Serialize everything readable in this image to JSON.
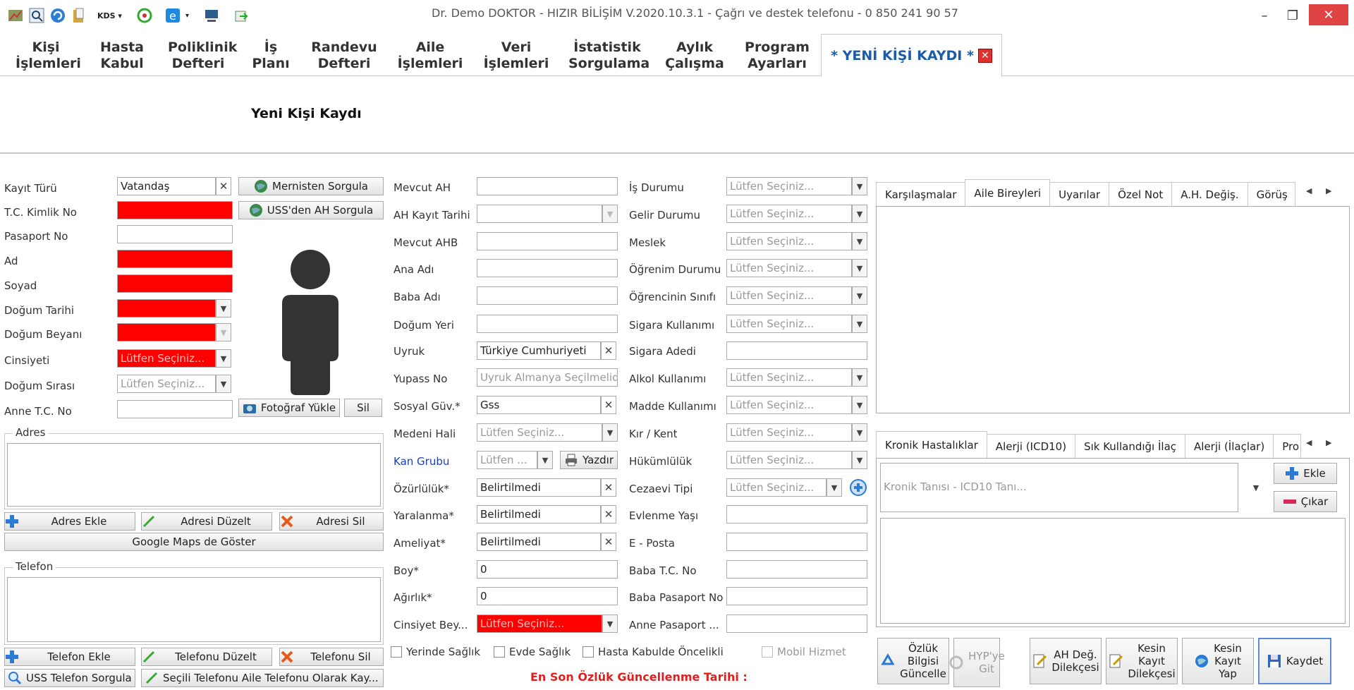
{
  "window": {
    "title": "Dr. Demo DOKTOR - HIZIR BİLİŞİM V.2020.10.3.1 - Çağrı ve destek telefonu - 0 850 241 90 57",
    "kds": "KDS"
  },
  "menu": [
    {
      "l1": "Kişi",
      "l2": "İşlemleri"
    },
    {
      "l1": "Hasta",
      "l2": "Kabul"
    },
    {
      "l1": "Poliklinik",
      "l2": "Defteri"
    },
    {
      "l1": "İş",
      "l2": "Planı"
    },
    {
      "l1": "Randevu",
      "l2": "Defteri"
    },
    {
      "l1": "Aile",
      "l2": "İşlemleri"
    },
    {
      "l1": "Veri",
      "l2": "İşlemleri"
    },
    {
      "l1": "İstatistik",
      "l2": "Sorgulama"
    },
    {
      "l1": "Aylık",
      "l2": "Çalışma"
    },
    {
      "l1": "Program",
      "l2": "Ayarları"
    }
  ],
  "active_tab": "* YENİ KİŞİ KAYDI *",
  "header_title": "Yeni Kişi Kaydı",
  "col1": {
    "kayit_turu": {
      "label": "Kayıt Türü",
      "value": "Vatandaş"
    },
    "tc": {
      "label": "T.C. Kimlik No"
    },
    "pasaport": {
      "label": "Pasaport No"
    },
    "ad": {
      "label": "Ad"
    },
    "soyad": {
      "label": "Soyad"
    },
    "dogum_tarihi": {
      "label": "Doğum Tarihi"
    },
    "dogum_beyani": {
      "label": "Doğum Beyanı"
    },
    "cinsiyet": {
      "label": "Cinsiyeti",
      "value": "Lütfen Seçiniz..."
    },
    "dogum_sirasi": {
      "label": "Doğum Sırası",
      "value": "Lütfen Seçiniz..."
    },
    "anne_tc": {
      "label": "Anne T.C. No"
    },
    "mernis_btn": "Mernisten Sorgula",
    "uss_btn": "USS'den AH Sorgula",
    "foto_btn": "Fotoğraf Yükle",
    "sil_btn": "Sil",
    "adres_title": "Adres",
    "adres_ekle": "Adres Ekle",
    "adres_duzelt": "Adresi Düzelt",
    "adres_sil": "Adresi Sil",
    "google_maps": "Google Maps de Göster",
    "telefon_title": "Telefon",
    "telefon_ekle": "Telefon Ekle",
    "telefon_duzelt": "Telefonu Düzelt",
    "telefon_sil": "Telefonu Sil",
    "uss_telefon": "USS Telefon Sorgula",
    "secili_telefon": "Seçili Telefonu Aile Telefonu Olarak Kay..."
  },
  "col2": {
    "mevcut_ah": {
      "label": "Mevcut AH"
    },
    "ah_kayit_tarihi": {
      "label": "AH Kayıt Tarihi"
    },
    "mevcut_ahb": {
      "label": "Mevcut AHB"
    },
    "ana_adi": {
      "label": "Ana Adı"
    },
    "baba_adi": {
      "label": "Baba Adı"
    },
    "dogum_yeri": {
      "label": "Doğum Yeri"
    },
    "uyruk": {
      "label": "Uyruk",
      "value": "Türkiye Cumhuriyeti"
    },
    "yupass": {
      "label": "Yupass  No",
      "placeholder": "Uyruk Almanya Seçilmelidir"
    },
    "sosyal_guv": {
      "label": "Sosyal Güv.*",
      "value": "Gss"
    },
    "medeni_hali": {
      "label": "Medeni Hali",
      "value": "Lütfen Seçiniz..."
    },
    "kan_grubu": {
      "label": "Kan Grubu",
      "value": "Lütfen ..."
    },
    "yazdir": "Yazdır",
    "ozurluluk": {
      "label": "Özürlülük*",
      "value": "Belirtilmedi"
    },
    "yaralanma": {
      "label": "Yaralanma*",
      "value": "Belirtilmedi"
    },
    "ameliyat": {
      "label": "Ameliyat*",
      "value": "Belirtilmedi"
    },
    "boy": {
      "label": "Boy*",
      "value": "0"
    },
    "agirlik": {
      "label": "Ağırlık*",
      "value": "0"
    },
    "cinsiyet_bey": {
      "label": "Cinsiyet Bey...",
      "value": "Lütfen Seçiniz..."
    }
  },
  "col3": {
    "is_durumu": {
      "label": "İş Durumu",
      "value": "Lütfen Seçiniz..."
    },
    "gelir_durumu": {
      "label": "Gelir Durumu",
      "value": "Lütfen Seçiniz..."
    },
    "meslek": {
      "label": "Meslek",
      "value": "Lütfen Seçiniz..."
    },
    "ogrenim": {
      "label": "Öğrenim Durumu",
      "value": "Lütfen Seçiniz..."
    },
    "ogrenci_sinifi": {
      "label": "Öğrencinin Sınıfı",
      "value": "Lütfen Seçiniz..."
    },
    "sigara_kul": {
      "label": "Sigara Kullanımı",
      "value": "Lütfen Seçiniz..."
    },
    "sigara_adedi": {
      "label": "Sigara Adedi"
    },
    "alkol": {
      "label": "Alkol Kullanımı",
      "value": "Lütfen Seçiniz..."
    },
    "madde": {
      "label": "Madde Kullanımı",
      "value": "Lütfen Seçiniz..."
    },
    "kir_kent": {
      "label": "Kır / Kent",
      "value": "Lütfen Seçiniz..."
    },
    "hukumluluk": {
      "label": "Hükümlülük",
      "value": "Lütfen Seçiniz..."
    },
    "cezaevi": {
      "label": "Cezaevi Tipi",
      "value": "Lütfen Seçiniz..."
    },
    "evlenme_yasi": {
      "label": "Evlenme Yaşı"
    },
    "eposta": {
      "label": "E - Posta"
    },
    "baba_tc": {
      "label": "Baba T.C. No"
    },
    "baba_pasaport": {
      "label": "Baba Pasaport No"
    },
    "anne_pasaport": {
      "label": "Anne Pasaport ..."
    }
  },
  "checks": {
    "yerinde": "Yerinde Sağlık",
    "evde": "Evde Sağlık",
    "hasta_kabul": "Hasta Kabulde Öncelikli",
    "mobil": "Mobil Hizmet"
  },
  "footer_note": "En Son Özlük Güncellenme Tarihi :",
  "right_tabs_top": [
    "Karşılaşmalar",
    "Aile Bireyleri",
    "Uyarılar",
    "Özel Not",
    "A.H. Değiş.",
    "Görüş"
  ],
  "right_tabs_bottom": [
    "Kronik Hastalıklar",
    "Alerji (ICD10)",
    "Sık Kullandığı İlaç",
    "Alerji (İlaçlar)",
    "Pro"
  ],
  "kronik": {
    "placeholder": "Kronik Tanısı - ICD10 Tanı...",
    "ekle": "Ekle",
    "cikar": "Çıkar"
  },
  "bottom_buttons": {
    "ozluk": [
      "Özlük",
      "Bilgisi",
      "Güncelle"
    ],
    "hyp": [
      "HYP'ye",
      "Git"
    ],
    "ah_deg": [
      "AH Değ.",
      "Dilekçesi"
    ],
    "kesin_dilekce": [
      "Kesin",
      "Kayıt",
      "Dilekçesi"
    ],
    "kesin_kayit": [
      "Kesin",
      "Kayıt",
      "Yap"
    ],
    "kaydet": "Kaydet"
  },
  "colors": {
    "required": "#ff0000",
    "accent": "#1c5ba8",
    "warning_text": "#e02020"
  }
}
